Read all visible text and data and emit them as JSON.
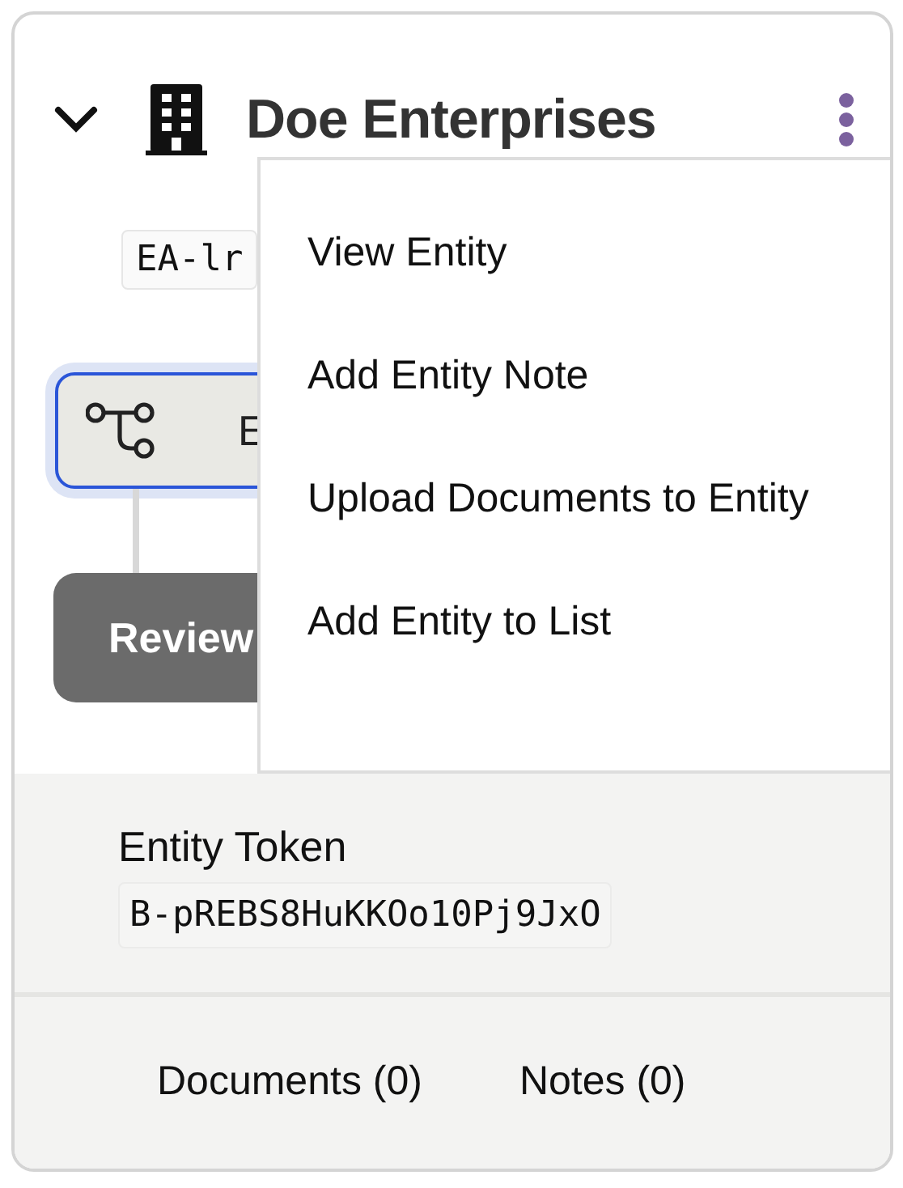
{
  "entity": {
    "name": "Doe Enterprises",
    "expanded": true,
    "code": "EA-lr"
  },
  "steps": [
    {
      "kind": "node",
      "label": "E"
    },
    {
      "kind": "button",
      "label": "Review"
    }
  ],
  "menu": {
    "items": [
      {
        "label": "View Entity"
      },
      {
        "label": "Add Entity Note"
      },
      {
        "label": "Upload Documents to Entity"
      },
      {
        "label": "Add Entity to List"
      }
    ]
  },
  "token": {
    "label": "Entity Token",
    "value": "B-pREBS8HuKKOo10Pj9JxO"
  },
  "tabs": [
    {
      "label": "Documents (0)"
    },
    {
      "label": "Notes (0)"
    }
  ]
}
